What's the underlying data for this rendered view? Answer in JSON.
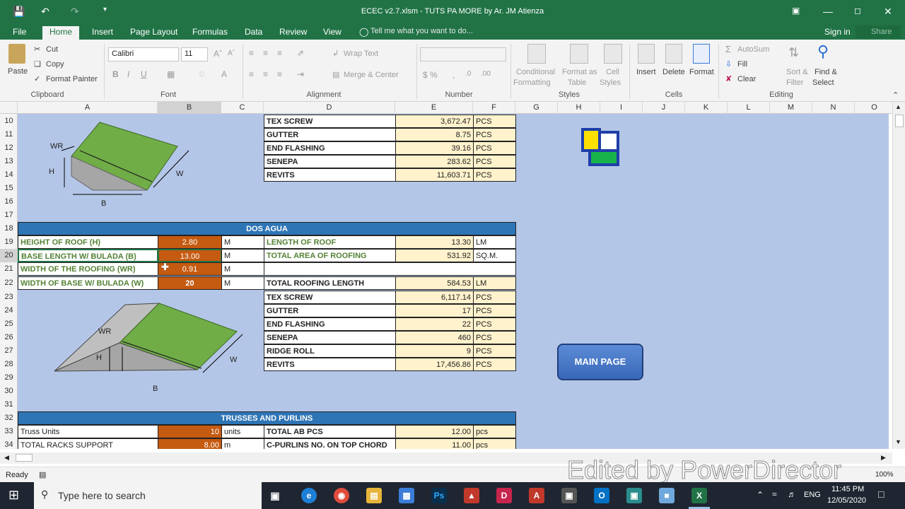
{
  "window": {
    "title": "ECEC v2.7.xlsm - TUTS PA MORE by Ar. JM Atienza"
  },
  "tabs": [
    {
      "label": "File"
    },
    {
      "label": "Home"
    },
    {
      "label": "Insert"
    },
    {
      "label": "Page Layout"
    },
    {
      "label": "Formulas"
    },
    {
      "label": "Data"
    },
    {
      "label": "Review"
    },
    {
      "label": "View"
    }
  ],
  "tellme": "Tell me what you want to do...",
  "signin": "Sign in",
  "share": "Share",
  "ribbon": {
    "clipboard": {
      "paste": "Paste",
      "cut": "Cut",
      "copy": "Copy",
      "painter": "Format Painter",
      "group": "Clipboard"
    },
    "font": {
      "name": "Calibri",
      "size": "11",
      "group": "Font"
    },
    "alignment": {
      "wrap": "Wrap Text",
      "merge": "Merge & Center",
      "group": "Alignment"
    },
    "number": {
      "group": "Number"
    },
    "styles": {
      "cond": "Conditional",
      "cond2": "Formatting",
      "fmt": "Format as",
      "fmt2": "Table",
      "cell": "Cell",
      "cell2": "Styles",
      "group": "Styles"
    },
    "cells": {
      "insert": "Insert",
      "delete": "Delete",
      "format": "Format",
      "group": "Cells"
    },
    "editing": {
      "autosum": "AutoSum",
      "fill": "Fill",
      "clear": "Clear",
      "sort": "Sort &",
      "sort2": "Filter",
      "find": "Find &",
      "find2": "Select",
      "group": "Editing"
    }
  },
  "columns": [
    "A",
    "B",
    "C",
    "D",
    "E",
    "F",
    "G",
    "H",
    "I",
    "J",
    "K",
    "L",
    "M",
    "N",
    "O"
  ],
  "rows": [
    "10",
    "11",
    "12",
    "13",
    "14",
    "15",
    "16",
    "17",
    "18",
    "19",
    "20",
    "21",
    "22",
    "23",
    "24",
    "25",
    "26",
    "27",
    "28",
    "29",
    "30",
    "31",
    "32",
    "33",
    "34"
  ],
  "top_table": [
    {
      "label": "TEX SCREW",
      "value": "3,672.47",
      "unit": "PCS"
    },
    {
      "label": "GUTTER",
      "value": "8.75",
      "unit": "PCS"
    },
    {
      "label": "END FLASHING",
      "value": "39.16",
      "unit": "PCS"
    },
    {
      "label": "SENEPA",
      "value": "283.62",
      "unit": "PCS"
    },
    {
      "label": "REVITS",
      "value": "11,603.71",
      "unit": "PCS"
    }
  ],
  "diagram1": {
    "wr": "WR",
    "h": "H",
    "w": "W",
    "b": "B"
  },
  "diagram2": {
    "wr": "WR",
    "h": "H",
    "w": "W",
    "b": "B"
  },
  "dos_agua": {
    "title": "DOS AGUA",
    "inputs": [
      {
        "label": "HEIGHT OF ROOF (H)",
        "value": "2.80",
        "unit": "M"
      },
      {
        "label": "BASE LENGTH W/ BULADA (B)",
        "value": "13.00",
        "unit": "M"
      },
      {
        "label": "WIDTH OF THE ROOFING (WR)",
        "value": "0.91",
        "unit": "M"
      },
      {
        "label": "WIDTH OF BASE W/ BULADA (W)",
        "value": "20",
        "unit": "M"
      }
    ],
    "results": [
      {
        "label": "LENGTH OF ROOF",
        "value": "13.30",
        "unit": "LM"
      },
      {
        "label": "TOTAL AREA OF ROOFING",
        "value": "531.92",
        "unit": "SQ.M."
      }
    ],
    "totals": [
      {
        "label": "TOTAL ROOFING LENGTH",
        "value": "584.53",
        "unit": "LM"
      },
      {
        "label": "TEX SCREW",
        "value": "6,117.14",
        "unit": "PCS"
      },
      {
        "label": "GUTTER",
        "value": "17",
        "unit": "PCS"
      },
      {
        "label": "END FLASHING",
        "value": "22",
        "unit": "PCS"
      },
      {
        "label": "SENEPA",
        "value": "460",
        "unit": "PCS"
      },
      {
        "label": "RIDGE ROLL",
        "value": "9",
        "unit": "PCS"
      },
      {
        "label": "REVITS",
        "value": "17,456.86",
        "unit": "PCS"
      }
    ]
  },
  "trusses": {
    "title": "TRUSSES AND PURLINS",
    "rows": [
      {
        "label": "Truss Units",
        "value": "10",
        "unit": "units",
        "rlabel": "TOTAL AB PCS",
        "rvalue": "12.00",
        "runit": "pcs"
      },
      {
        "label": "TOTAL RACKS SUPPORT",
        "value": "8.00",
        "unit": "m",
        "rlabel": "C-PURLINS NO. ON TOP CHORD",
        "rvalue": "11.00",
        "runit": "pcs"
      }
    ]
  },
  "main_page_button": "MAIN PAGE",
  "status": {
    "ready": "Ready",
    "zoom": "100%"
  },
  "watermark": "Edited by PowerDirector",
  "taskbar": {
    "search": "Type here to search",
    "lang": "ENG",
    "time": "11:45 PM",
    "date": "12/05/2020"
  },
  "colors": {
    "excel_green": "#217346",
    "sheet_bg": "#b4c6e7",
    "header_blue": "#2e75b6",
    "input_orange": "#c55a11",
    "result_yellow": "#fff2cc",
    "label_green": "#548235"
  }
}
